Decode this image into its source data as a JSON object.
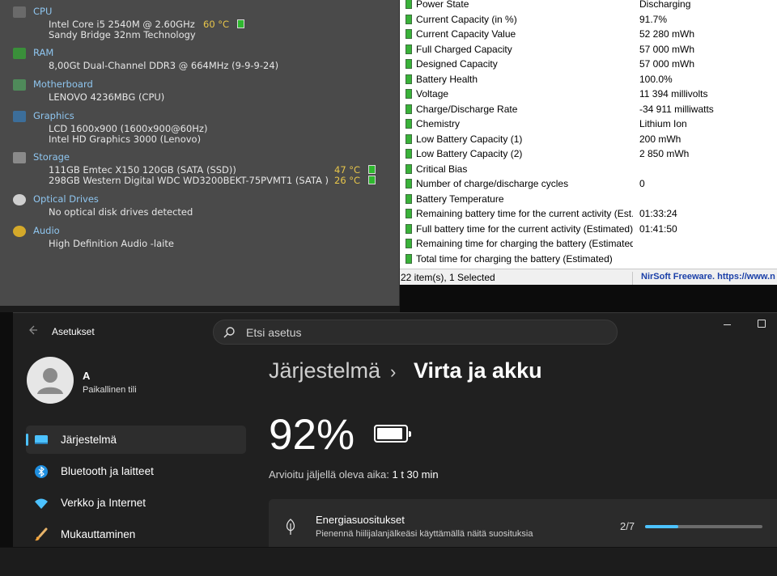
{
  "speccy": {
    "sections": [
      {
        "key": "cpu",
        "heading": "CPU",
        "lines": [
          "Intel Core i5 2540M @ 2.60GHz",
          "Sandy Bridge 32nm Technology"
        ],
        "temps": [
          "60 °C"
        ],
        "icon": "cpu-icon",
        "icon_color": "#6a6a6a"
      },
      {
        "key": "ram",
        "heading": "RAM",
        "lines": [
          "8,00Gt Dual-Channel DDR3 @ 664MHz (9-9-9-24)"
        ],
        "temps": [],
        "icon": "ram-icon",
        "icon_color": "#3a8f3a"
      },
      {
        "key": "motherboard",
        "heading": "Motherboard",
        "lines": [
          "LENOVO 4236MBG (CPU)"
        ],
        "temps": [],
        "icon": "motherboard-icon",
        "icon_color": "#4f8a5a"
      },
      {
        "key": "graphics",
        "heading": "Graphics",
        "lines": [
          "LCD 1600x900 (1600x900@60Hz)",
          "Intel HD Graphics 3000 (Lenovo)"
        ],
        "temps": [],
        "icon": "monitor-icon",
        "icon_color": "#3c6e9a"
      },
      {
        "key": "storage",
        "heading": "Storage",
        "lines": [
          "111GB Emtec X150 120GB (SATA (SSD))",
          "298GB Western Digital WDC WD3200BEKT-75PVMT1 (SATA )"
        ],
        "temps": [
          "47 °C",
          "26 °C"
        ],
        "icon": "hard-drive-icon",
        "icon_color": "#8a8a8a"
      },
      {
        "key": "optical",
        "heading": "Optical Drives",
        "lines": [
          "No optical disk drives detected"
        ],
        "temps": [],
        "icon": "optical-disc-icon",
        "icon_color": "#cfcfcf"
      },
      {
        "key": "audio",
        "heading": "Audio",
        "lines": [
          "High Definition Audio -laite"
        ],
        "temps": [],
        "icon": "speaker-icon",
        "icon_color": "#d4a92a"
      }
    ],
    "heading_color": "#8fc6f0",
    "temp_color": "#e8c64a"
  },
  "battery_info": {
    "rows": [
      {
        "name": "Power State",
        "value": "Discharging"
      },
      {
        "name": "Current Capacity (in %)",
        "value": "91.7%"
      },
      {
        "name": "Current Capacity Value",
        "value": "52 280 mWh"
      },
      {
        "name": "Full Charged Capacity",
        "value": "57 000 mWh"
      },
      {
        "name": "Designed Capacity",
        "value": "57 000 mWh"
      },
      {
        "name": "Battery Health",
        "value": "100.0%"
      },
      {
        "name": "Voltage",
        "value": "11 394 millivolts"
      },
      {
        "name": "Charge/Discharge Rate",
        "value": "-34 911 milliwatts"
      },
      {
        "name": "Chemistry",
        "value": "Lithium Ion"
      },
      {
        "name": "Low Battery Capacity (1)",
        "value": "200 mWh"
      },
      {
        "name": "Low Battery Capacity (2)",
        "value": "2 850 mWh"
      },
      {
        "name": "Critical Bias",
        "value": ""
      },
      {
        "name": "Number of charge/discharge cycles",
        "value": "0"
      },
      {
        "name": "Battery Temperature",
        "value": ""
      },
      {
        "name": "Remaining battery time for the current activity (Est...",
        "value": "01:33:24"
      },
      {
        "name": "Full battery time for the current activity (Estimated)",
        "value": "01:41:50"
      },
      {
        "name": "Remaining time for charging the battery (Estimated)",
        "value": ""
      },
      {
        "name": "Total  time for charging the battery (Estimated)",
        "value": ""
      }
    ],
    "status_left": "22 item(s), 1 Selected",
    "status_right": "NirSoft Freeware. https://www.n"
  },
  "settings": {
    "app_title": "Asetukset",
    "search_placeholder": "Etsi asetus",
    "user": {
      "name": "A",
      "account_type": "Paikallinen tili"
    },
    "nav": [
      {
        "label": "Järjestelmä",
        "icon": "system-display-icon",
        "active": true
      },
      {
        "label": "Bluetooth ja laitteet",
        "icon": "bluetooth-icon",
        "active": false
      },
      {
        "label": "Verkko ja Internet",
        "icon": "wifi-icon",
        "active": false
      },
      {
        "label": "Mukauttaminen",
        "icon": "paintbrush-icon",
        "active": false
      }
    ],
    "breadcrumb": {
      "parent": "Järjestelmä",
      "separator": "›",
      "current": "Virta ja akku"
    },
    "battery_percent": "92%",
    "battery_level": 0.92,
    "time_left_label": "Arvioitu jäljellä oleva aika:",
    "time_left_value": "1 t 30 min",
    "energy": {
      "title": "Energiasuositukset",
      "subtitle": "Pienennä hiilijalanjälkeäsi käyttämällä näitä suosituksia",
      "count": "2/7",
      "progress": 0.2857
    },
    "accent_color": "#4cc2ff"
  }
}
